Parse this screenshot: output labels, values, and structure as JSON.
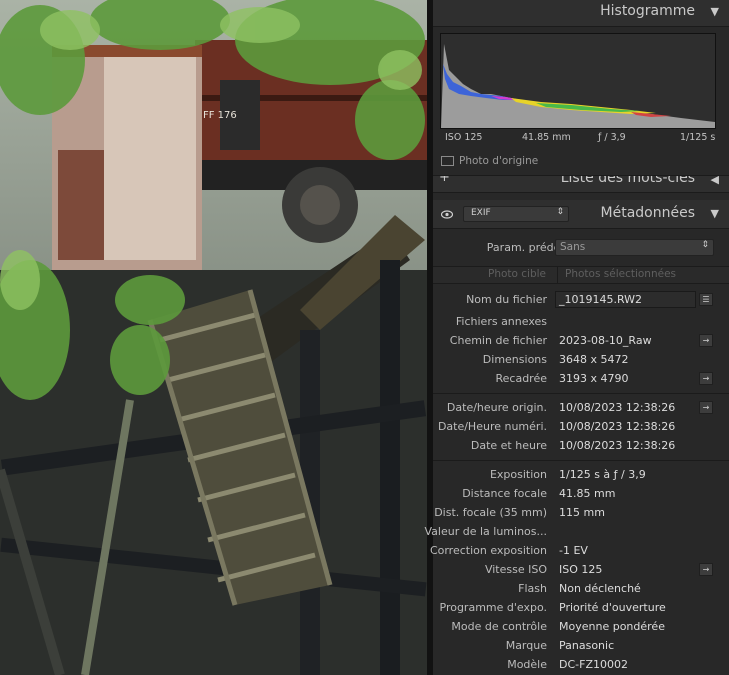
{
  "histogram": {
    "title": "Histogramme",
    "iso": "ISO 125",
    "focal": "41.85 mm",
    "aperture": "ƒ / 3,9",
    "shutter": "1/125 s",
    "original_photo": "Photo d'origine"
  },
  "keywords": {
    "title": "Liste des mots-clés"
  },
  "metadata": {
    "title": "Métadonnées",
    "view_select": "EXIF",
    "preset_label": "Param. prédéf.",
    "preset_value": "Sans",
    "target_photo": "Photo cible",
    "selected_photos": "Photos sélectionnées",
    "fields": {
      "filename": {
        "label": "Nom du fichier",
        "value": "_1019145.RW2"
      },
      "sidecar": {
        "label": "Fichiers annexes",
        "value": ""
      },
      "folder": {
        "label": "Chemin de fichier",
        "value": "2023-08-10_Raw"
      },
      "dimensions": {
        "label": "Dimensions",
        "value": "3648 x 5472"
      },
      "crop": {
        "label": "Recadrée",
        "value": "3193 x 4790"
      },
      "date_orig": {
        "label": "Date/heure origin.",
        "value": "10/08/2023 12:38:26"
      },
      "date_digit": {
        "label": "Date/Heure numéri.",
        "value": "10/08/2023 12:38:26"
      },
      "date_time": {
        "label": "Date et heure",
        "value": "10/08/2023 12:38:26"
      },
      "exposure": {
        "label": "Exposition",
        "value": "1/125 s à ƒ / 3,9"
      },
      "focal": {
        "label": "Distance focale",
        "value": "41.85 mm"
      },
      "focal35": {
        "label": "Dist. focale (35 mm)",
        "value": "115 mm"
      },
      "brightness": {
        "label": "Valeur de la luminos...",
        "value": ""
      },
      "exp_comp": {
        "label": "Correction exposition",
        "value": "-1 EV"
      },
      "iso": {
        "label": "Vitesse ISO",
        "value": "ISO 125"
      },
      "flash": {
        "label": "Flash",
        "value": "Non déclenché"
      },
      "program": {
        "label": "Programme d'expo.",
        "value": "Priorité d'ouverture"
      },
      "metering": {
        "label": "Mode de contrôle",
        "value": "Moyenne pondérée"
      },
      "make": {
        "label": "Marque",
        "value": "Panasonic"
      },
      "model": {
        "label": "Modèle",
        "value": "DC-FZ10002"
      }
    }
  },
  "photo": {
    "wagon_text": "FF 176"
  },
  "colors": {
    "panel_bg": "#282828",
    "header_bg": "#2f2f2f",
    "text": "#bcbcbc",
    "leaf": "#6fa64a",
    "rust": "#8a4a2e"
  }
}
